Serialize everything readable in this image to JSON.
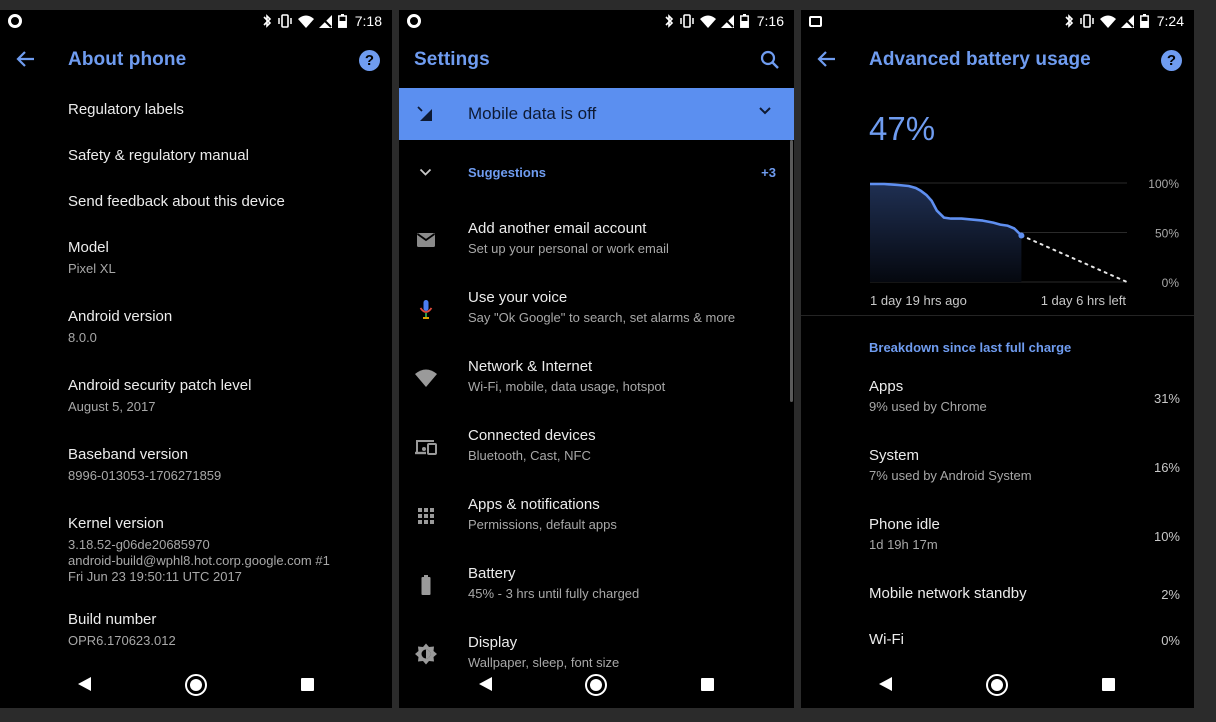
{
  "colors": {
    "accent": "#6f9cf0",
    "banner": "#5b8ff0",
    "background": "#000000"
  },
  "screen1": {
    "status_time": "7:18",
    "title": "About phone",
    "help_glyph": "?",
    "items": [
      {
        "title": "Regulatory labels",
        "sub": ""
      },
      {
        "title": "Safety & regulatory manual",
        "sub": ""
      },
      {
        "title": "Send feedback about this device",
        "sub": ""
      },
      {
        "title": "Model",
        "sub": "Pixel XL"
      },
      {
        "title": "Android version",
        "sub": "8.0.0"
      },
      {
        "title": "Android security patch level",
        "sub": "August 5, 2017"
      },
      {
        "title": "Baseband version",
        "sub": "8996-013053-1706271859"
      },
      {
        "title": "Kernel version",
        "sub1": "3.18.52-g06de20685970",
        "sub2": "android-build@wphl8.hot.corp.google.com #1",
        "sub3": "Fri Jun 23 19:50:11 UTC 2017"
      },
      {
        "title": "Build number",
        "sub": "OPR6.170623.012"
      }
    ]
  },
  "screen2": {
    "status_time": "7:16",
    "title": "Settings",
    "banner_text": "Mobile data is off",
    "suggestions_label": "Suggestions",
    "suggestions_count": "+3",
    "items": [
      {
        "icon": "email-icon",
        "title": "Add another email account",
        "sub": "Set up your personal or work email"
      },
      {
        "icon": "microphone-icon",
        "title": "Use your voice",
        "sub": "Say \"Ok Google\" to search, set alarms & more"
      },
      {
        "icon": "wifi-icon",
        "title": "Network & Internet",
        "sub": "Wi-Fi, mobile, data usage, hotspot"
      },
      {
        "icon": "devices-icon",
        "title": "Connected devices",
        "sub": "Bluetooth, Cast, NFC"
      },
      {
        "icon": "apps-grid-icon",
        "title": "Apps & notifications",
        "sub": "Permissions, default apps"
      },
      {
        "icon": "battery-icon",
        "title": "Battery",
        "sub": "45% - 3 hrs until fully charged"
      },
      {
        "icon": "brightness-icon",
        "title": "Display",
        "sub": "Wallpaper, sleep, font size"
      }
    ]
  },
  "screen3": {
    "status_time": "7:24",
    "title": "Advanced battery usage",
    "help_glyph": "?",
    "battery_percent": "47%",
    "chart_label_start": "1 day 19 hrs ago",
    "chart_label_end": "1 day 6 hrs left",
    "breakdown_label": "Breakdown since last full charge",
    "items": [
      {
        "title": "Apps",
        "sub": "9% used by Chrome",
        "pct": "31%"
      },
      {
        "title": "System",
        "sub": "7% used by Android System",
        "pct": "16%"
      },
      {
        "title": "Phone idle",
        "sub": "1d 19h 17m",
        "pct": "10%"
      },
      {
        "title": "Mobile network standby",
        "sub": "",
        "pct": "2%"
      },
      {
        "title": "Wi-Fi",
        "sub": "",
        "pct": "0%"
      }
    ]
  },
  "chart_data": {
    "type": "line",
    "title": "",
    "xlabel": "",
    "ylabel": "",
    "x_tick_labels": [
      "1 day 19 hrs ago",
      "1 day 6 hrs left"
    ],
    "y_tick_labels": [
      "100%",
      "50%",
      "0%"
    ],
    "ylim": [
      0,
      100
    ],
    "x_unit": "hours from start",
    "xlim": [
      0,
      73
    ],
    "grid": true,
    "series": [
      {
        "segment": "measured",
        "x": [
          0,
          4,
          8,
          11,
          13,
          14.5,
          16,
          17.5,
          19,
          21,
          23,
          26,
          29,
          32,
          35,
          37,
          39,
          41,
          43
        ],
        "y": [
          99,
          99,
          98,
          97,
          95,
          92,
          88,
          82,
          72,
          65,
          64,
          64,
          63,
          62,
          60,
          58,
          57,
          54,
          47
        ]
      },
      {
        "segment": "projected",
        "style": "dotted",
        "x": [
          43,
          73
        ],
        "y": [
          47,
          0
        ]
      }
    ]
  }
}
